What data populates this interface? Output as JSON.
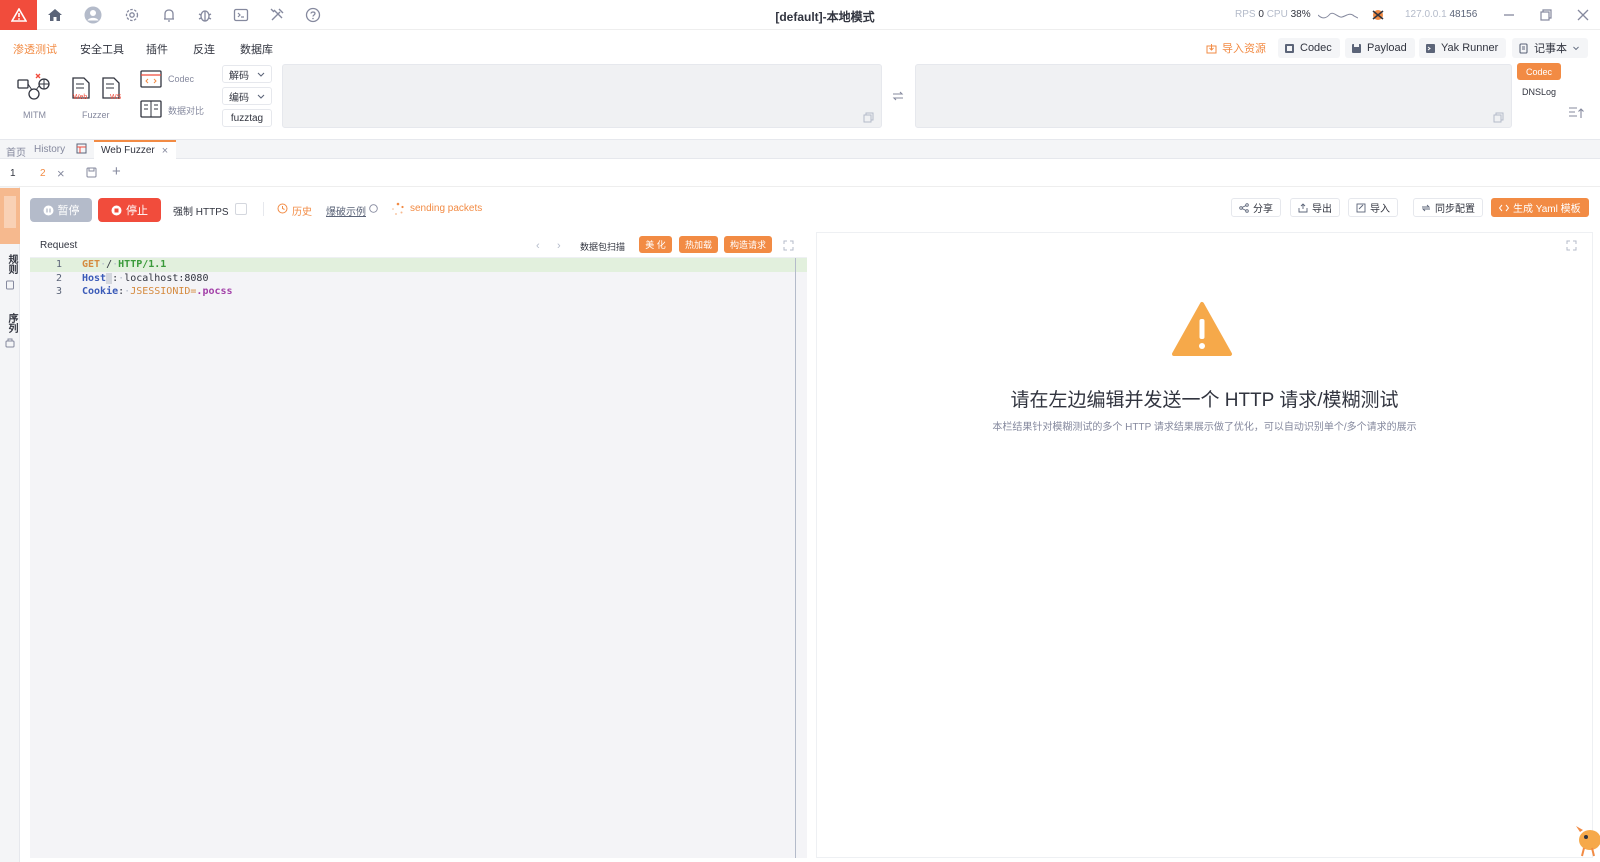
{
  "window": {
    "title": "[default]-本地模式",
    "rps_label": "RPS",
    "rps_value": "0",
    "cpu_label": "CPU",
    "cpu_value": "38%",
    "ip": "127.0.0.1",
    "port": "48156"
  },
  "menu": {
    "items": [
      "渗透测试",
      "安全工具",
      "插件",
      "反连",
      "数据库"
    ],
    "tools": [
      {
        "label": "导入资源",
        "icon": "import-icon"
      },
      {
        "label": "Codec",
        "icon": "codec-icon"
      },
      {
        "label": "Payload",
        "icon": "payload-icon"
      },
      {
        "label": "Yak Runner",
        "icon": "terminal-icon"
      },
      {
        "label": "记事本",
        "icon": "notebook-icon"
      }
    ]
  },
  "toolbox": {
    "mitm_label": "MITM",
    "fuzzer_label": "Fuzzer",
    "web_label": "Web",
    "ws_label": "WS",
    "codec_label": "Codec",
    "compare_label": "数据对比",
    "decode_label": "解码",
    "encode_label": "编码",
    "fuzztag_label": "fuzztag",
    "side_codec": "Codec",
    "side_dnslog": "DNSLog"
  },
  "tabs": {
    "home": "首页",
    "history": "History",
    "webfuzzer": "Web Fuzzer"
  },
  "subtabs": {
    "first": "1",
    "second": "2"
  },
  "vertical_tabs": [
    "规则",
    "序列"
  ],
  "controls": {
    "pause": "暂停",
    "stop": "停止",
    "force_https": "强制 HTTPS",
    "history": "历史",
    "blast_example": "爆破示例",
    "sending": "sending packets",
    "share": "分享",
    "export": "导出",
    "import": "导入",
    "sync": "同步配置",
    "yaml": "生成 Yaml 模板"
  },
  "request": {
    "title": "Request",
    "scan": "数据包扫描",
    "beautify": "美 化",
    "hotload": "热加载",
    "construct": "构造请求",
    "lines": [
      {
        "n": "1",
        "method": "GET",
        "path": "/",
        "version": "HTTP/1.1"
      },
      {
        "n": "2",
        "key": "Host",
        "value": "localhost:8080"
      },
      {
        "n": "3",
        "key": "Cookie",
        "value": "JSESSIONID=",
        "tag": ".pocss"
      }
    ]
  },
  "response": {
    "empty_title": "请在左边编辑并发送一个 HTTP 请求/模糊测试",
    "empty_desc": "本栏结果针对模糊测试的多个 HTTP 请求结果展示做了优化，可以自动识别单个/多个请求的展示"
  },
  "colors": {
    "accent": "#f28b44",
    "danger": "#f14c3c",
    "warning_icon": "#f6a94a"
  }
}
